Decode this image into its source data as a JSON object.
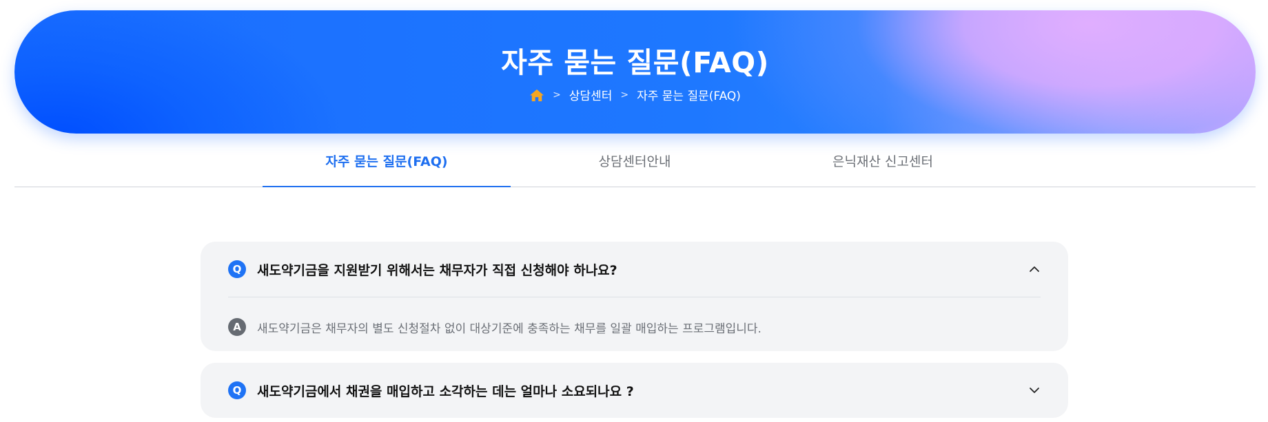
{
  "hero": {
    "title": "자주 묻는 질문(FAQ)",
    "breadcrumb": {
      "home_icon": "home-icon",
      "items": [
        "상담센터",
        "자주 묻는 질문(FAQ)"
      ],
      "separator": ">"
    }
  },
  "tabs": [
    {
      "label": "자주 묻는 질문(FAQ)",
      "active": true
    },
    {
      "label": "상담센터안내",
      "active": false
    },
    {
      "label": "은닉재산 신고센터",
      "active": false
    }
  ],
  "faq": [
    {
      "q_badge": "Q",
      "question": "새도약기금을 지원받기 위해서는 채무자가 직접 신청해야 하나요?",
      "expanded": true,
      "a_badge": "A",
      "answer": "새도약기금은 채무자의 별도 신청절차 없이 대상기준에 충족하는 채무를 일괄 매입하는 프로그램입니다.",
      "toggle_icon": "chevron-up-icon"
    },
    {
      "q_badge": "Q",
      "question": "새도약기금에서 채권을 매입하고 소각하는 데는 얼마나 소요되나요 ?",
      "expanded": false,
      "toggle_icon": "chevron-down-icon"
    }
  ],
  "colors": {
    "accent": "#1e6ff0",
    "hero_gradient_start": "#1a6dff",
    "hero_gradient_end": "#e0acff",
    "home_icon": "#f5a623",
    "faq_background": "#f3f4f6",
    "answer_badge": "#666b72"
  }
}
